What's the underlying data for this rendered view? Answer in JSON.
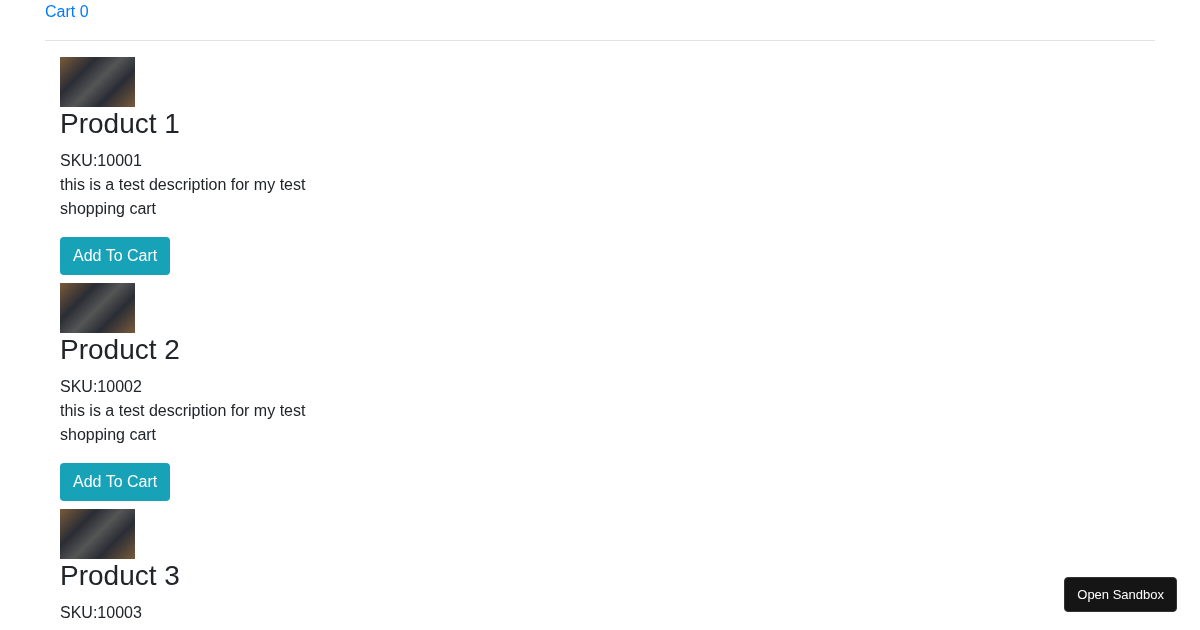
{
  "cart_link": "Cart 0",
  "products": [
    {
      "title": "Product 1",
      "sku": "SKU:10001",
      "description": "this is a test description for my test shopping cart",
      "button": "Add To Cart"
    },
    {
      "title": "Product 2",
      "sku": "SKU:10002",
      "description": "this is a test description for my test shopping cart",
      "button": "Add To Cart"
    },
    {
      "title": "Product 3",
      "sku": "SKU:10003"
    }
  ],
  "sandbox_button": "Open Sandbox"
}
